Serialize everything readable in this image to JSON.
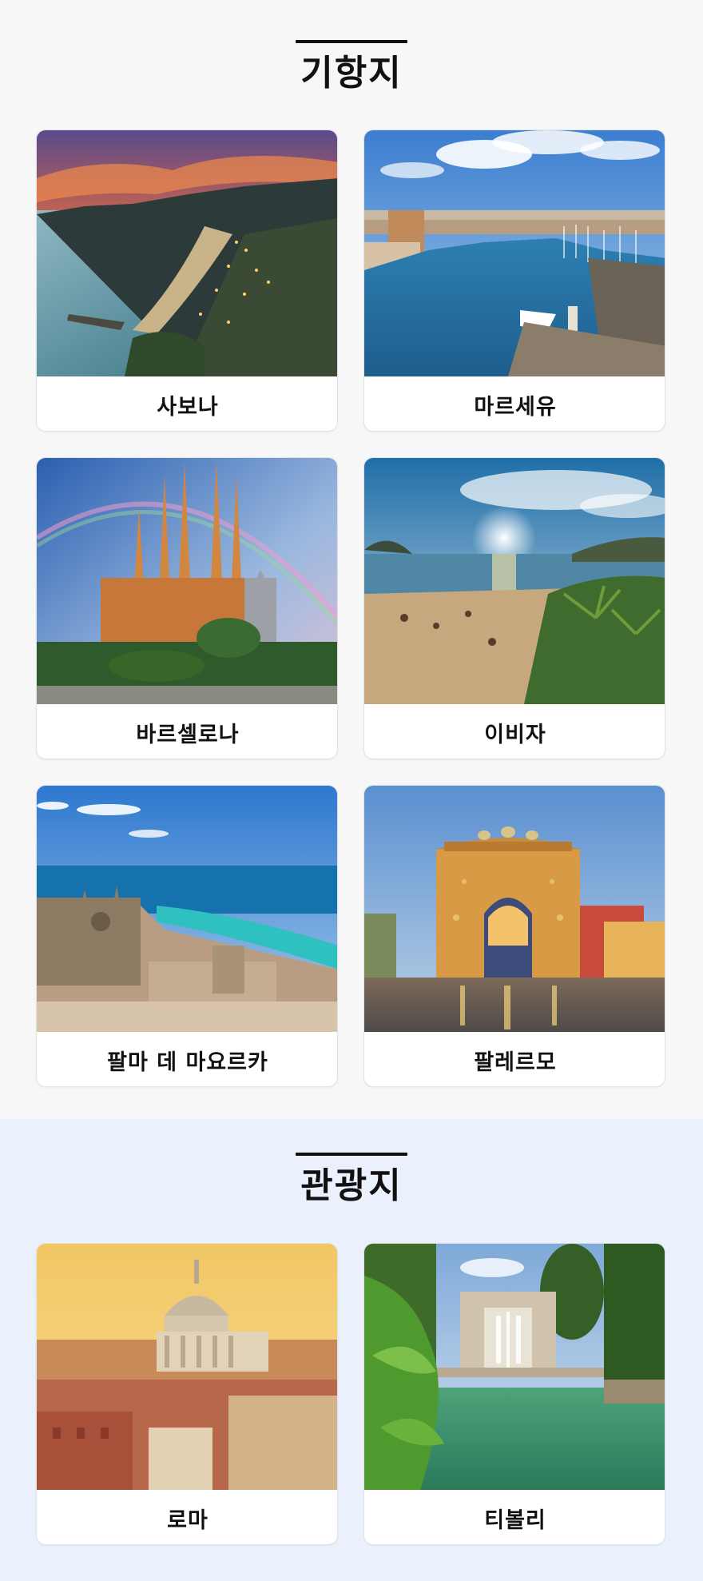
{
  "sections": [
    {
      "title": "기항지",
      "cards": [
        {
          "name": "사보나"
        },
        {
          "name": "마르세유"
        },
        {
          "name": "바르셀로나"
        },
        {
          "name": "이비자"
        },
        {
          "name": "팔마 데 마요르카"
        },
        {
          "name": "팔레르모"
        }
      ]
    },
    {
      "title": "관광지",
      "cards": [
        {
          "name": "로마"
        },
        {
          "name": "티볼리"
        }
      ]
    }
  ],
  "colors": {
    "page_bg": "#f7f7f7",
    "sights_bg": "#eaf1fd",
    "title": "#111111",
    "card_border": "#dfe3ea"
  }
}
